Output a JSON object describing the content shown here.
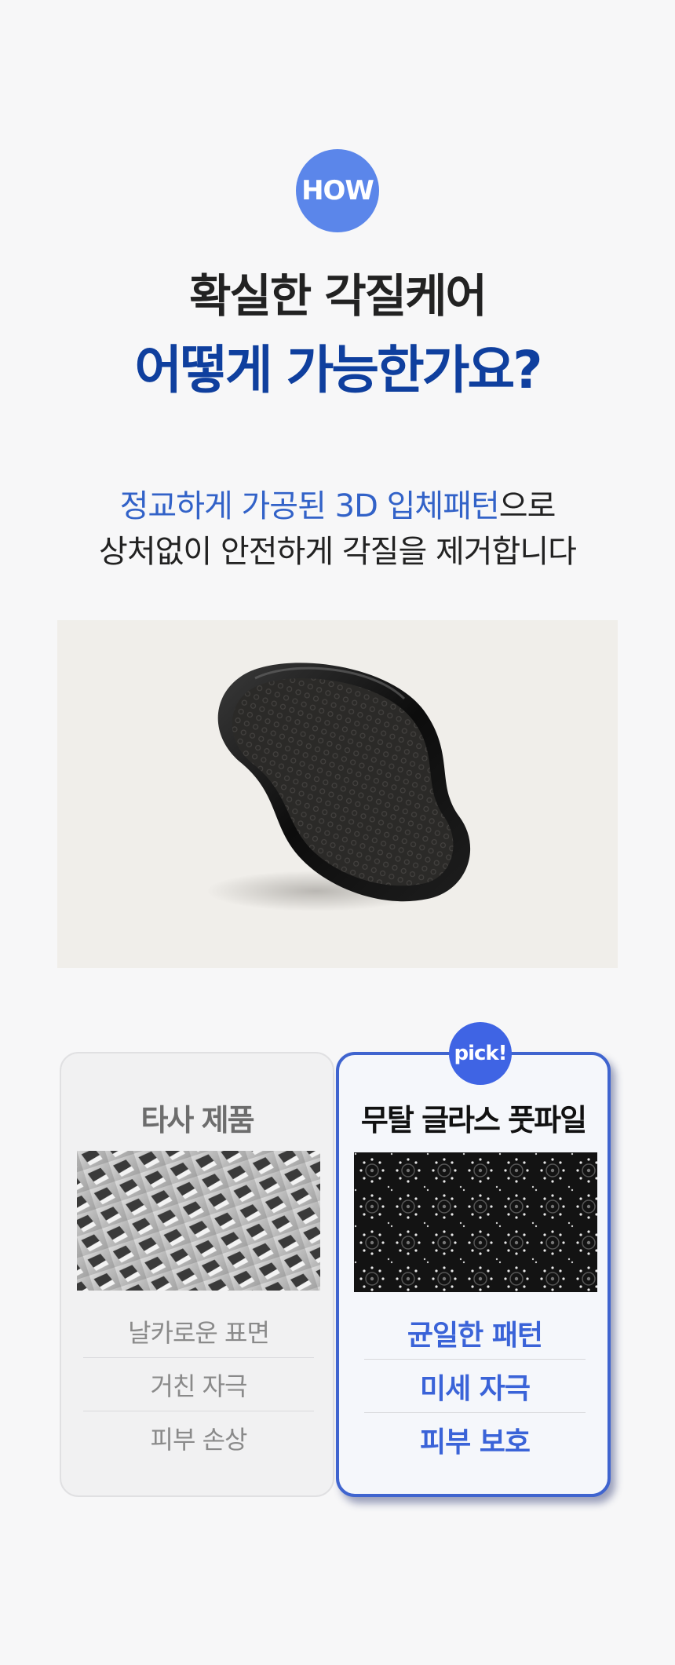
{
  "badge": {
    "label": "HOW"
  },
  "headline": {
    "line1": "확실한 각질케어",
    "line2": "어떻게 가능한가요?"
  },
  "subtitle": {
    "line1_highlight": "정교하게 가공된 3D 입체패턴",
    "line1_rest": "으로",
    "line2": "상처없이 안전하게 각질을 제거합니다"
  },
  "comparison": {
    "pick_label": "pick!",
    "other": {
      "title": "타사 제품",
      "features": [
        "날카로운 표면",
        "거친 자극",
        "피부 손상"
      ]
    },
    "mutal": {
      "title": "무탈 글라스 풋파일",
      "features": [
        "균일한 패턴",
        "미세 자극",
        "피부 보호"
      ]
    }
  },
  "colors": {
    "accent": "#5b86ea",
    "headline_blue": "#0f3f9e",
    "highlight_blue": "#3262c8",
    "card_border": "#3f64cf",
    "feature_blue": "#3a63d8"
  }
}
